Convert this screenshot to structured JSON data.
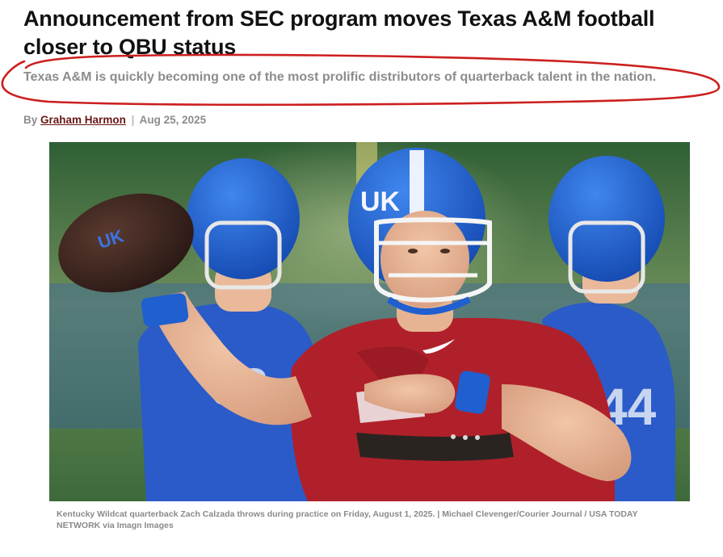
{
  "article": {
    "headline": "Announcement from SEC program moves Texas A&M football closer to QBU status",
    "subheadline": "Texas A&M is quickly becoming one of the most prolific distributors of quarterback talent in the nation.",
    "byline_prefix": "By",
    "author": "Graham Harmon",
    "separator": "|",
    "date": "Aug 25, 2025"
  },
  "image": {
    "caption": "Kentucky Wildcat quarterback Zach Calzada throws during practice on Friday, August 1, 2025. | Michael Clevenger/Courier Journal / USA TODAY NETWORK via Imagn Images",
    "ball_logo": "UK",
    "helmet_logo": "UK",
    "jersey_numbers": [
      "93",
      "44"
    ]
  },
  "colors": {
    "headline": "#111111",
    "subheadline": "#8c8c8c",
    "author_link": "#6a1515",
    "annotation_circle": "#cc1f1f",
    "kentucky_blue": "#1f5fd0",
    "practice_red": "#b0202a"
  }
}
